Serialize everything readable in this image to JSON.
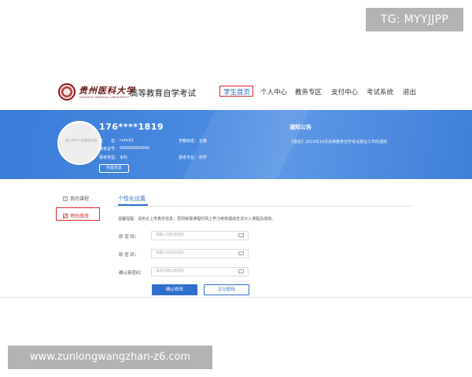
{
  "watermarks": {
    "top": "TG: MYYJJPP",
    "bottom": "www.zunlongwangzhan-z6.com"
  },
  "header": {
    "logo_cn": "贵州医科大学",
    "logo_en": "GUIZHOU MEDICAL UNIVERSITY",
    "site_title": "高等教育自学考试",
    "nav": [
      "学生首页",
      "个人中心",
      "教务专区",
      "支付中心",
      "考试系统",
      "退出"
    ],
    "active_nav": "学生首页"
  },
  "banner": {
    "avatar_text": "请上传本人近期证件照",
    "phone": "176****1819",
    "fields": {
      "name_label": "姓　　名：",
      "name_value": "cehs01",
      "cert_label": "准考证号：",
      "cert_value": "000000000000",
      "type_label": "报考类型：",
      "type_value": "本科",
      "status_label": "学籍状态：",
      "status_value": "在籍",
      "major_label": "报考专业：",
      "major_value": "药学"
    },
    "complete_info_button": "完善信息",
    "notice_title": "通知公告",
    "notice_item": "【报名】2019年10月高等教育自学考试报名工作的通知"
  },
  "sidebar": {
    "items": [
      "我的课程",
      "密码修改"
    ],
    "active_item": "密码修改"
  },
  "form": {
    "tab": "个性化设置",
    "tip": "温馨提醒：请务必上传真实信息，否则审报课程时网上学习考核或成无法计入课程总成绩。",
    "fields": [
      {
        "label": "原 密 码：",
        "placeholder": "请输入您的原密码"
      },
      {
        "label": "新 密 码：",
        "placeholder": "请输入您的新密码"
      },
      {
        "label": "确认新密码：",
        "placeholder": "请再次确认新密码"
      }
    ],
    "confirm_button": "确认修改",
    "forgot_button": "忘记密码"
  },
  "colors": {
    "accent_blue": "#2f6fcd",
    "banner_blue": "#3a7cd9",
    "highlight_red": "#d62a2a",
    "logo_maroon": "#6a1313"
  }
}
